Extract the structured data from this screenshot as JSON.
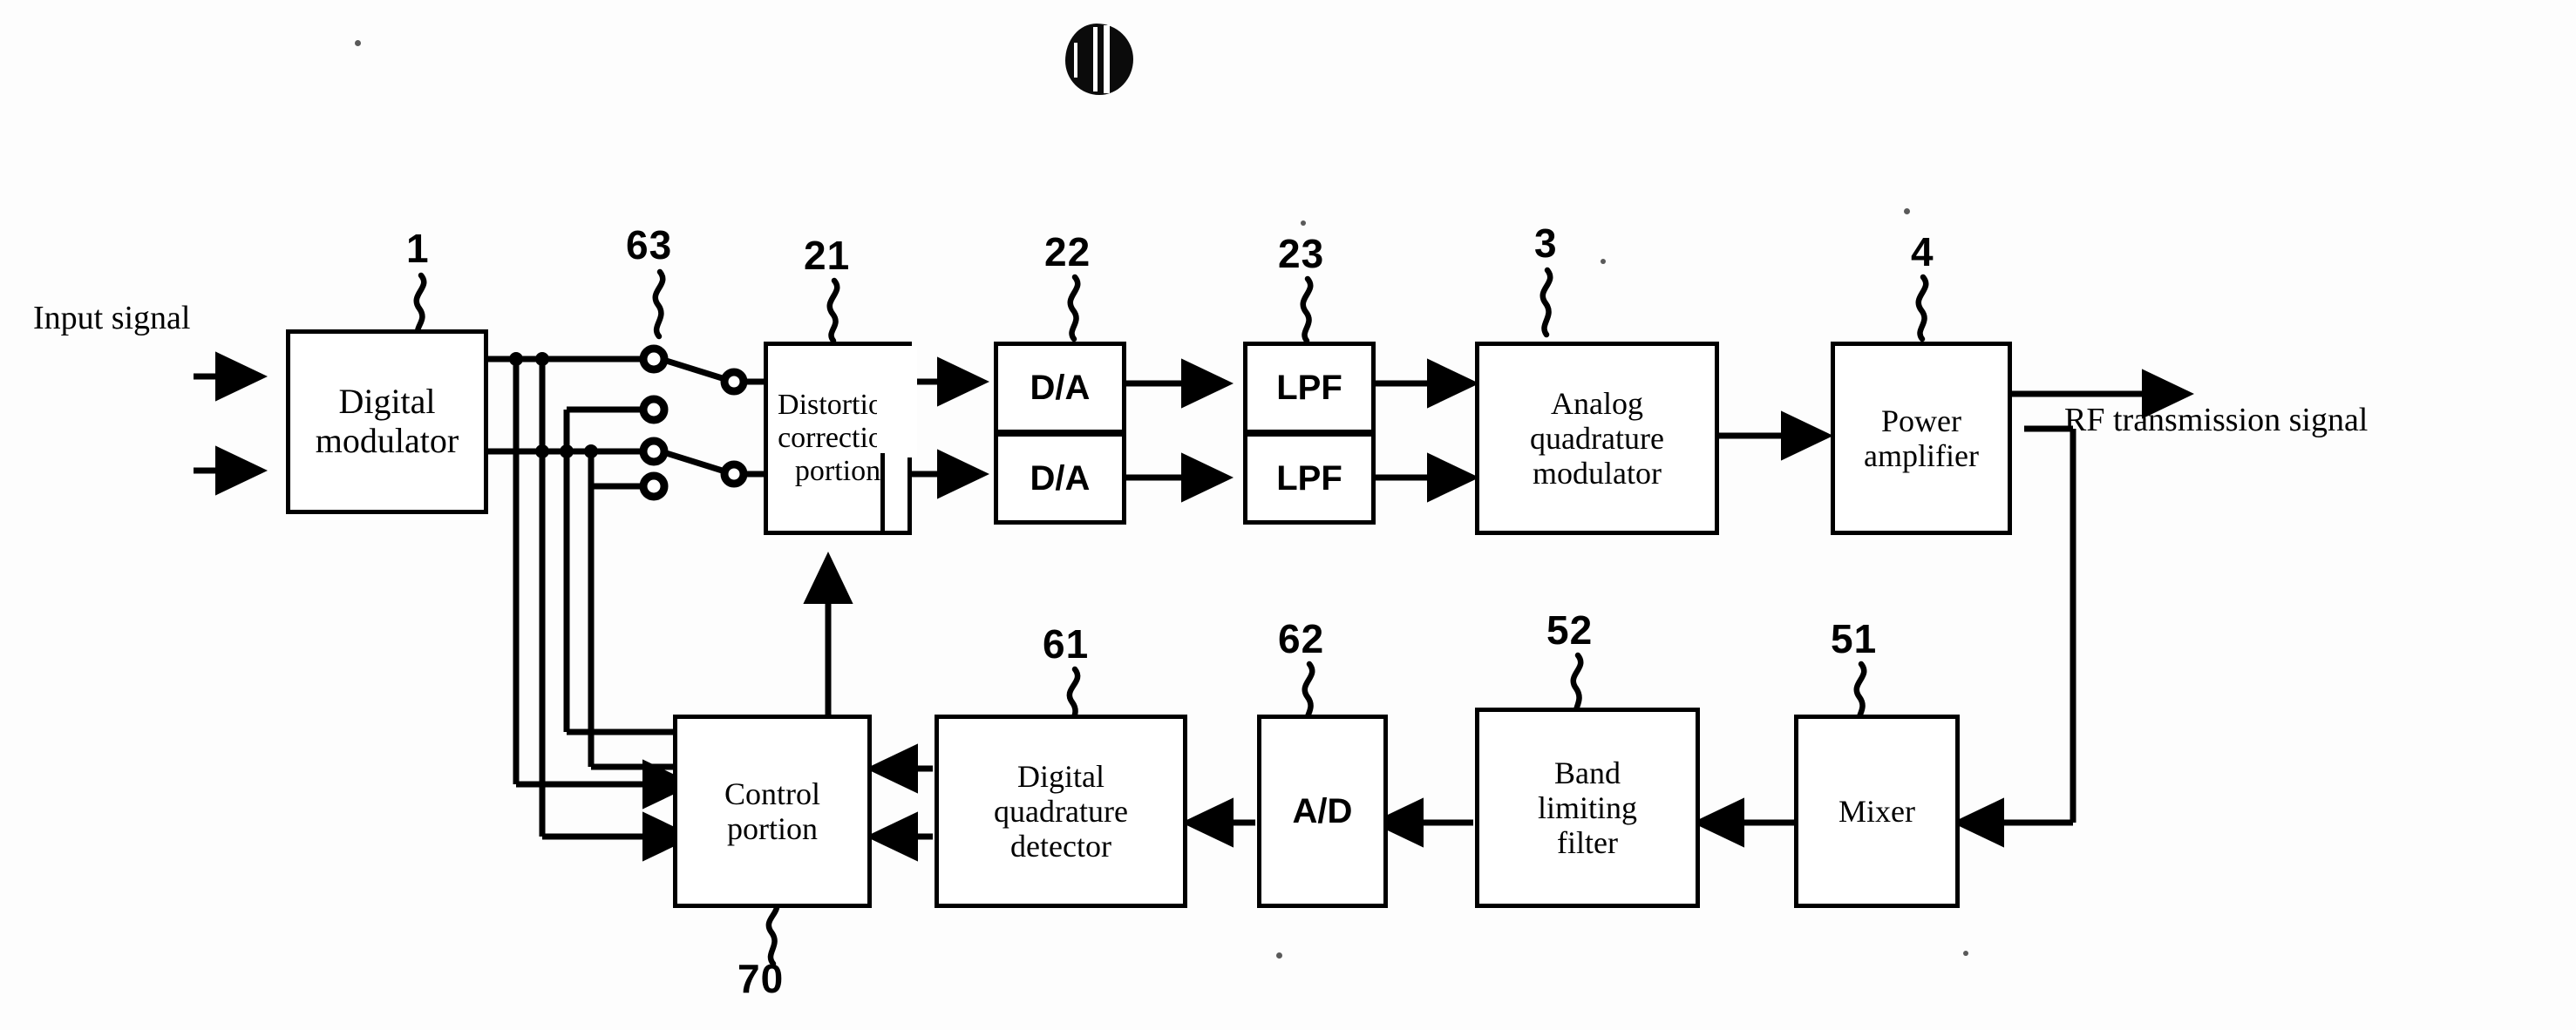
{
  "figure": {
    "type": "patent-block-diagram",
    "title_text": "",
    "input_label": "Input signal",
    "output_label": "RF transmission signal"
  },
  "blocks": [
    {
      "id": "digital_modulator",
      "label": "Digital\nmodulator",
      "ref": "1"
    },
    {
      "id": "distortion_correction",
      "label": "Distortion\ncorrection\nportion",
      "ref": "21"
    },
    {
      "id": "da_upper",
      "label": "D/A",
      "ref": "22"
    },
    {
      "id": "da_lower",
      "label": "D/A",
      "ref": ""
    },
    {
      "id": "lpf_upper",
      "label": "LPF",
      "ref": "23"
    },
    {
      "id": "lpf_lower",
      "label": "LPF",
      "ref": ""
    },
    {
      "id": "analog_quad_modulator",
      "label": "Analog\nquadrature\nmodulator",
      "ref": "3"
    },
    {
      "id": "power_amplifier",
      "label": "Power\namplifier",
      "ref": "4"
    },
    {
      "id": "control_portion",
      "label": "Control\nportion",
      "ref": "70"
    },
    {
      "id": "digital_quad_detector",
      "label": "Digital\nquadrature\ndetector",
      "ref": "61"
    },
    {
      "id": "ad_converter",
      "label": "A/D",
      "ref": "62"
    },
    {
      "id": "band_limiting_filter",
      "label": "Band\nlimiting\nfilter",
      "ref": "52"
    },
    {
      "id": "mixer",
      "label": "Mixer",
      "ref": "51"
    }
  ],
  "block_labels": {
    "digital_modulator_l1": "Digital",
    "digital_modulator_l2": "modulator",
    "distortion_l1": "Distortion",
    "distortion_l2": "correction",
    "distortion_l3": "portion",
    "da_upper": "D/A",
    "da_lower": "D/A",
    "lpf_upper": "LPF",
    "lpf_lower": "LPF",
    "analog_l1": "Analog",
    "analog_l2": "quadrature",
    "analog_l3": "modulator",
    "power_l1": "Power",
    "power_l2": "amplifier",
    "control_l1": "Control",
    "control_l2": "portion",
    "dqd_l1": "Digital",
    "dqd_l2": "quadrature",
    "dqd_l3": "detector",
    "ad": "A/D",
    "blf_l1": "Band",
    "blf_l2": "limiting",
    "blf_l3": "filter",
    "mixer": "Mixer"
  },
  "reference_numerals": {
    "n1": "1",
    "n63": "63",
    "n21": "21",
    "n22": "22",
    "n23": "23",
    "n3": "3",
    "n4": "4",
    "n61": "61",
    "n62": "62",
    "n52": "52",
    "n51": "51",
    "n70": "70"
  },
  "switch": {
    "ref": "63",
    "name": "switch-bank",
    "pole_count": 4,
    "closed_paths": 2
  },
  "colors": {
    "ink": "#000000",
    "paper": "#fdfdfd"
  }
}
